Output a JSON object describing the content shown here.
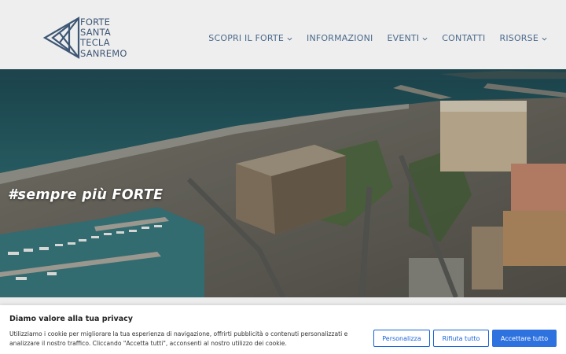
{
  "brand": {
    "lines": [
      "FORTE",
      "SANTA",
      "TECLA",
      "SANREMO"
    ],
    "color": "#3e5775"
  },
  "nav": {
    "items": [
      {
        "label": "SCOPRI IL FORTE",
        "dropdown": true
      },
      {
        "label": "INFORMAZIONI",
        "dropdown": false
      },
      {
        "label": "EVENTI",
        "dropdown": true
      },
      {
        "label": "CONTATTI",
        "dropdown": false
      },
      {
        "label": "RISORSE",
        "dropdown": true
      }
    ],
    "color": "#4a6a8c"
  },
  "hero": {
    "title": "#sempre più FORTE",
    "image": "aerial-view-fortress-harbor"
  },
  "cookie": {
    "title": "Diamo valore alla tua privacy",
    "text": "Utilizziamo i cookie per migliorare la tua esperienza di navigazione, offrirti pubblicità o contenuti personalizzati e analizzare il nostro traffico. Cliccando \"Accetta tutti\", acconsenti al nostro utilizzo dei cookie.",
    "buttons": {
      "customize": "Personalizza",
      "reject": "Rifiuta tutto",
      "accept": "Accettare tutto"
    },
    "accent": "#1863dc"
  }
}
